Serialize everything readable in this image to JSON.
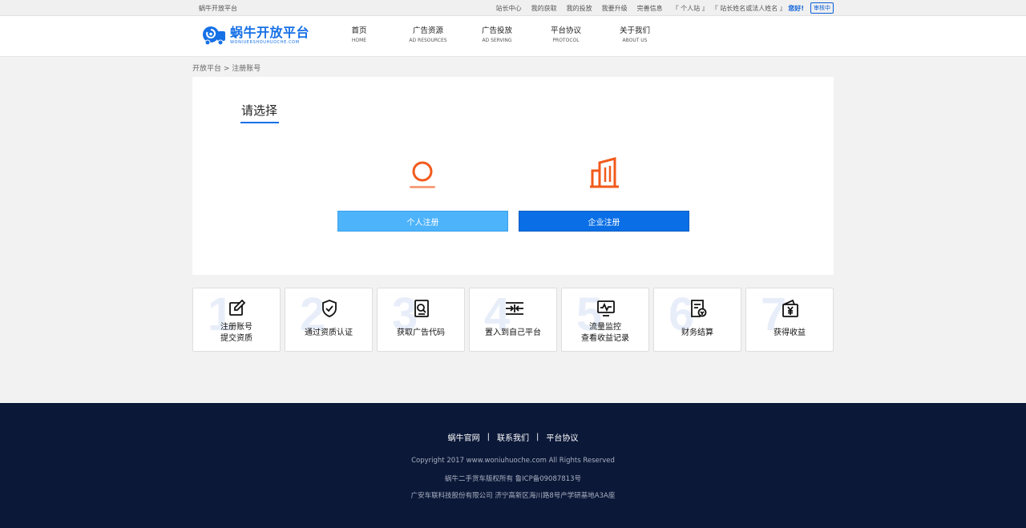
{
  "topbar": {
    "site_name": "蜗牛开放平台",
    "links": [
      "站长中心",
      "我的获取",
      "我的投放",
      "我要升级",
      "完善信息"
    ],
    "account_type": "『 个人站 』",
    "account_name": "『 站长姓名或法人姓名 』",
    "greeting": "您好!",
    "status_badge": "审核中"
  },
  "header": {
    "logo_title": "蜗牛开放平台",
    "logo_subtitle": "WONIUERSHOUHUOCHE.COM",
    "nav": [
      {
        "cn": "首页",
        "en": "HOME"
      },
      {
        "cn": "广告资源",
        "en": "AD RESOURCES"
      },
      {
        "cn": "广告投放",
        "en": "AD SERVING"
      },
      {
        "cn": "平台协议",
        "en": "PROTOCOL"
      },
      {
        "cn": "关于我们",
        "en": "ABOUT US"
      }
    ]
  },
  "breadcrumb": "开放平台 > 注册账号",
  "register": {
    "title": "请选择",
    "personal_button": "个人注册",
    "company_button": "企业注册"
  },
  "steps": [
    {
      "num": "1",
      "label": "注册账号\n提交资质",
      "icon": "edit-icon"
    },
    {
      "num": "2",
      "label": "通过资质认证",
      "icon": "shield-check-icon"
    },
    {
      "num": "3",
      "label": "获取广告代码",
      "icon": "document-search-icon"
    },
    {
      "num": "4",
      "label": "置入到自己平台",
      "icon": "merge-arrows-icon"
    },
    {
      "num": "5",
      "label": "流量监控\n查看收益记录",
      "icon": "monitor-chart-icon"
    },
    {
      "num": "6",
      "label": "财务结算",
      "icon": "invoice-icon"
    },
    {
      "num": "7",
      "label": "获得收益",
      "icon": "wallet-yen-icon"
    }
  ],
  "footer": {
    "links": [
      "蜗牛官网",
      "联系我们",
      "平台协议"
    ],
    "copyright": "Copyright 2017 www.woniuhuoche.com All Rights Reserved",
    "icp": "蜗牛二手货车版权所有 鲁ICP备09087813号",
    "address": "广安车联科技股份有限公司 济宁高新区海川路8号产学研基地A3A座"
  },
  "colors": {
    "brand_blue": "#1670e6",
    "personal_button": "#4db3fb",
    "company_button": "#0a6fe6",
    "icon_orange": "#f25a1c",
    "footer_bg": "#0b1838"
  }
}
